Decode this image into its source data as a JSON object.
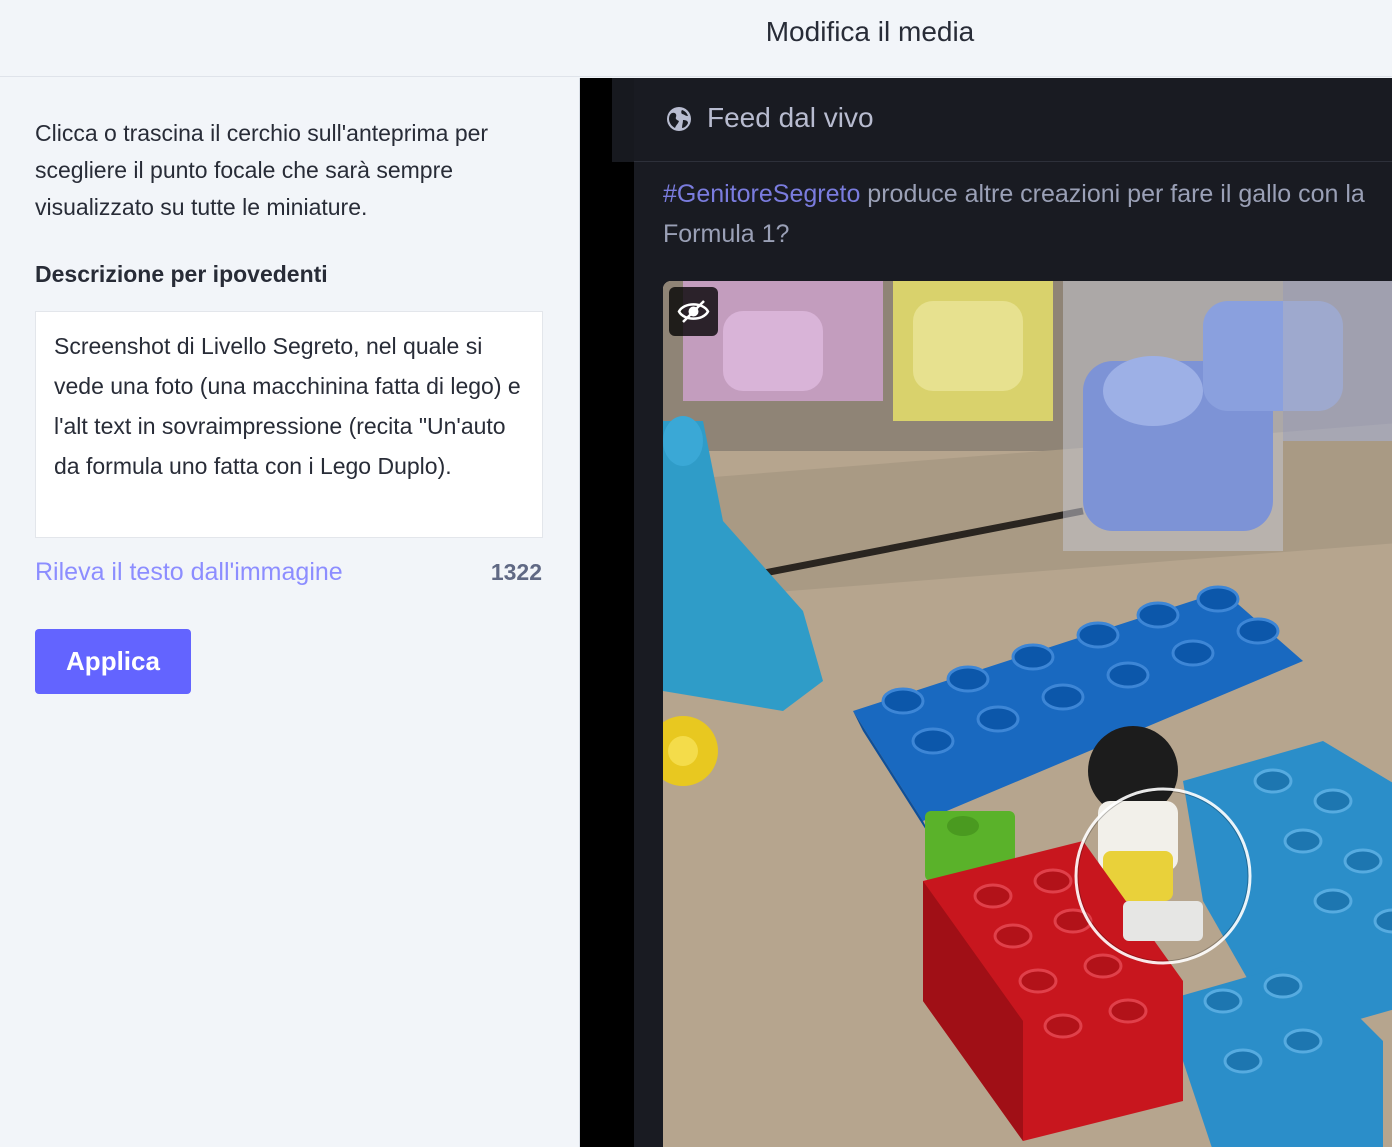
{
  "modal": {
    "title": "Modifica il media"
  },
  "editor": {
    "hint": "Clicca o trascina il cerchio sull'anteprima per scegliere il punto focale che sarà sempre visualizzato su tutte le miniature.",
    "description_label": "Descrizione per ipovedenti",
    "description_value": "Screenshot di Livello Segreto, nel quale si vede una foto (una macchinina fatta di lego) e l'alt text in sovraimpressione (recita \"Un'auto da formula uno fatta con i Lego Duplo).",
    "ocr_link": "Rileva il testo dall'immagine",
    "char_count": "1322",
    "apply_button": "Applica"
  },
  "preview": {
    "column_title": "Feed dal vivo",
    "column_icon": "globe-icon",
    "status_hashtag": "#GenitoreSegreto",
    "status_text": " produce altre creazioni per fare il gallo con la Formula 1?",
    "hide_media_icon": "eye-slash-icon"
  },
  "colors": {
    "accent": "#6364ff",
    "link": "#8c8dff",
    "dark_background": "#191b22"
  }
}
